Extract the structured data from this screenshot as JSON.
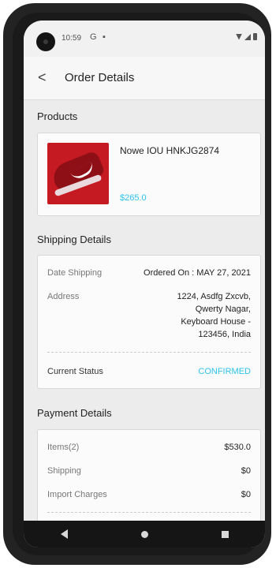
{
  "status_bar": {
    "time": "10:59",
    "icons": [
      "google-icon",
      "sim-icon"
    ],
    "right_icons": [
      "wifi-icon",
      "signal-icon",
      "battery-icon"
    ]
  },
  "appbar": {
    "back_icon": "back-arrow-icon",
    "title": "Order Details"
  },
  "products": {
    "section_title": "Products",
    "items": [
      {
        "image": "red-sneaker-image",
        "name": "Nowe IOU HNKJG2874",
        "price": "$265.0"
      }
    ]
  },
  "shipping": {
    "section_title": "Shipping Details",
    "date_label": "Date Shipping",
    "date_value": "Ordered On : MAY 27, 2021",
    "address_label": "Address",
    "address_lines": [
      "1224, Asdfg Zxcvb,",
      "Qwerty Nagar,",
      "Keyboard House -",
      "123456, India"
    ],
    "status_label": "Current Status",
    "status_value": "CONFIRMED"
  },
  "payment": {
    "section_title": "Payment Details",
    "rows": [
      {
        "label": "Items(2)",
        "value": "$530.0"
      },
      {
        "label": "Shipping",
        "value": "$0"
      },
      {
        "label": "Import Charges",
        "value": "$0"
      }
    ]
  },
  "colors": {
    "accent": "#2cc3e8",
    "product_bg": "#c51a22"
  }
}
